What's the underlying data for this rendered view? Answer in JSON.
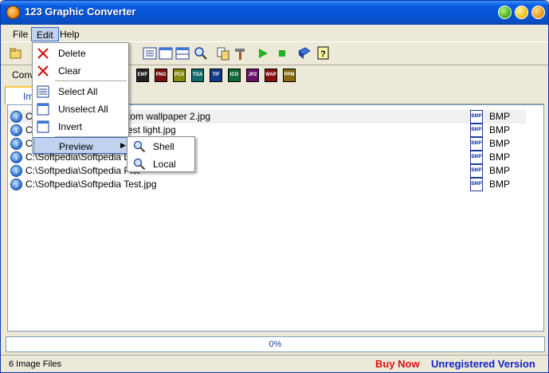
{
  "window": {
    "title": "123 Graphic Converter"
  },
  "menubar": {
    "items": [
      {
        "label": "File"
      },
      {
        "label": "Edit"
      },
      {
        "label": "Help"
      }
    ]
  },
  "formatbar": {
    "label": "Conv",
    "formats": [
      "EMF",
      "PNG",
      "PCX",
      "TGA",
      "TIF",
      "ICO",
      "JP2",
      "WAP",
      "PPM"
    ]
  },
  "tabs": [
    {
      "label": "Im"
    }
  ],
  "edit_menu": {
    "items": [
      {
        "label": "Delete",
        "icon": "x-icon"
      },
      {
        "label": "Clear",
        "icon": "x-icon"
      },
      {
        "label": "Select All",
        "icon": "list-icon"
      },
      {
        "label": "Unselect All",
        "icon": "box-icon"
      },
      {
        "label": "Invert",
        "icon": "box-icon"
      },
      {
        "label": "Preview",
        "icon": ""
      }
    ]
  },
  "preview_submenu": {
    "items": [
      {
        "label": "Shell",
        "icon": "magnifier-icon"
      },
      {
        "label": "Local",
        "icon": "magnifier-icon"
      }
    ]
  },
  "file_list": {
    "rows": [
      {
        "path": "C",
        "path_tail": "tom wallpaper 2.jpg",
        "type": "BMP"
      },
      {
        "path": "C",
        "path_tail": "est light.jpg",
        "type": "BMP"
      },
      {
        "path": "C",
        "path_tail": "",
        "type": "BMP"
      },
      {
        "path": "C:\\Softpedia\\Softpedia Lo",
        "path_tail": "",
        "type": "BMP"
      },
      {
        "path": "C:\\Softpedia\\Softpedia Pict",
        "path_tail": "",
        "type": "BMP"
      },
      {
        "path": "C:\\Softpedia\\Softpedia Test.jpg",
        "path_tail": "",
        "type": "BMP"
      }
    ]
  },
  "progress": {
    "value": 0,
    "text": "0%"
  },
  "status": {
    "count": "6 Image Files",
    "buy_now": "Buy Now",
    "unregistered": "Unregistered Version"
  },
  "colors": {
    "titlebar": "#0754d6",
    "buy_now": "#e01010",
    "unregistered": "#1420c8",
    "menu_highlight": "#c1d2ee"
  }
}
